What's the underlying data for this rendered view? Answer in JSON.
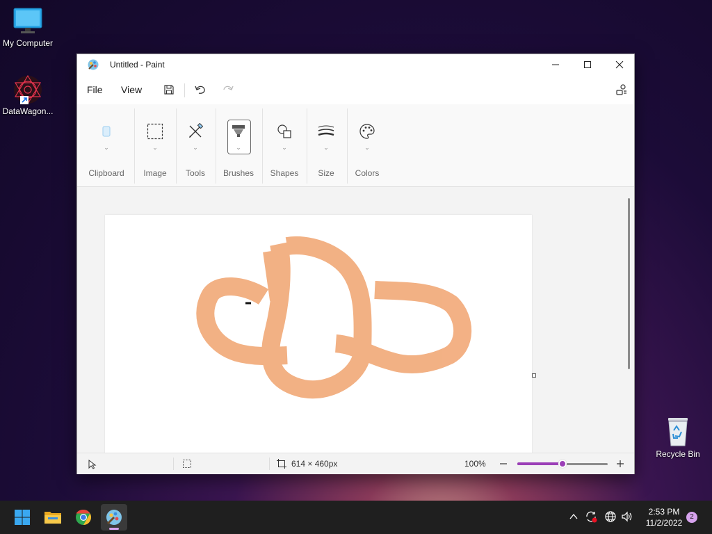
{
  "desktop": {
    "icons": [
      {
        "label": "My Computer",
        "icon": "monitor-icon"
      },
      {
        "label": "DataWagon...",
        "icon": "datawagon-icon"
      },
      {
        "label": "Recycle Bin",
        "icon": "recycle-bin-icon"
      }
    ]
  },
  "window": {
    "title": "Untitled - Paint",
    "menu": {
      "file": "File",
      "view": "View"
    },
    "ribbon": [
      {
        "label": "Clipboard",
        "icon": "clipboard-icon"
      },
      {
        "label": "Image",
        "icon": "selection-icon"
      },
      {
        "label": "Tools",
        "icon": "tools-icon"
      },
      {
        "label": "Brushes",
        "icon": "brush-icon"
      },
      {
        "label": "Shapes",
        "icon": "shapes-icon"
      },
      {
        "label": "Size",
        "icon": "size-icon"
      },
      {
        "label": "Colors",
        "icon": "palette-icon"
      }
    ],
    "canvas": {
      "stroke_color": "#f0a06a"
    },
    "status": {
      "canvas_size": "614 × 460px",
      "zoom": "100%",
      "zoom_fraction": 0.5
    }
  },
  "taskbar": {
    "clock_time": "2:53 PM",
    "clock_date": "11/2/2022",
    "notifications": "2"
  },
  "colors": {
    "accent": "#9b3fb7",
    "taskbar": "#1f1f1f"
  }
}
